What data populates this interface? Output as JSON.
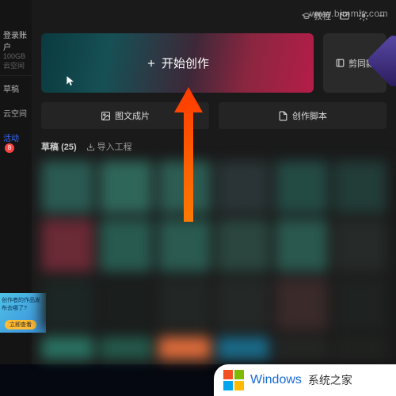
{
  "watermark": "www.bjmmlv.com",
  "topbar": {
    "tutorial": "教程",
    "badge_count": "8"
  },
  "sidebar": {
    "login_header": "登录账户",
    "login_sub": "100GB 云空间",
    "drafts": "草稿",
    "cloud": "云空间",
    "activity": "活动",
    "promo_title": "创作者的作品发布去哪了?",
    "promo_btn": "立即查看"
  },
  "hero": {
    "create": "开始创作",
    "same_style": "剪同款"
  },
  "subrow": {
    "image_to_video": "图文成片",
    "script": "创作脚本"
  },
  "drafts": {
    "label": "草稿",
    "count": "(25)",
    "import": "导入工程"
  },
  "footer": {
    "brand": "Windows",
    "site": "系统之家"
  },
  "tiles": [
    "#2a5a52",
    "#2f665a",
    "#2c5c52",
    "#2a3436",
    "#244a44",
    "#223c38",
    "#6a2a36",
    "#285a50",
    "#2a5a50",
    "#2a463e",
    "#2a584e",
    "#262a28",
    "#1c2624",
    "#1a1e1c",
    "#222624",
    "#242826",
    "#3a2a2a",
    "#1e2220",
    "#2a7060",
    "#24584a",
    "#d86a3a",
    "#1a6a88",
    "#242624",
    "#202220"
  ]
}
